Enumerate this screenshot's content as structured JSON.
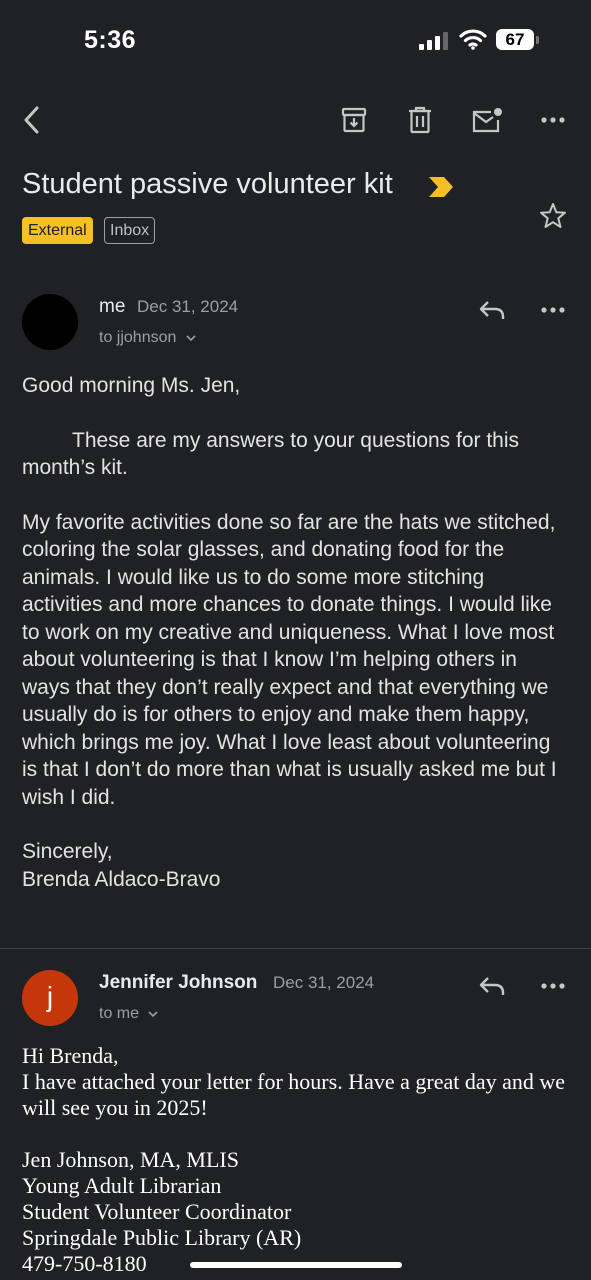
{
  "status_bar": {
    "time": "5:36",
    "battery": "67"
  },
  "toolbar": {
    "back_icon": "arrow-back-icon",
    "archive_icon": "archive-icon",
    "delete_icon": "trash-icon",
    "mark_unread_icon": "mail-unread-icon",
    "more_icon": "more-horizontal-icon"
  },
  "subject": "Student passive volunteer kit",
  "labels": {
    "external": "External",
    "inbox": "Inbox"
  },
  "colors": {
    "background": "#202124",
    "external_badge": "#f6bf26",
    "importance_marker": "#f6bf26",
    "avatar_jennifer": "#c5360b"
  },
  "messages": [
    {
      "sender": "me",
      "date": "Dec 31, 2024",
      "recipient": "to jjohnson",
      "body": {
        "greeting": "Good morning Ms. Jen,",
        "p1": "These are my answers to your questions for this month’s kit.",
        "p2": "My favorite activities done so far are the hats we stitched, coloring the solar glasses, and donating food for the animals. I would like us to do some more stitching activities and more chances to donate things. I would like to work on my creative and uniqueness. What I love most about volunteering is that I know I’m helping others in ways that they don’t really expect and that everything we usually do is for others to enjoy and make them happy, which brings me joy. What I love least about volunteering is that I don’t do more than what is usually asked me but I wish I did.",
        "closing": "Sincerely,",
        "signature": "Brenda Aldaco-Bravo"
      }
    },
    {
      "sender": "Jennifer Johnson",
      "avatar_letter": "j",
      "date": "Dec 31, 2024",
      "recipient": "to me",
      "body": {
        "greeting": "Hi Brenda,",
        "p1": "I have attached your letter for hours. Have a great day and we will see you in 2025!",
        "sig_name": "Jen Johnson, MA, MLIS",
        "sig_title1": "Young Adult Librarian",
        "sig_title2": "Student Volunteer Coordinator",
        "sig_org": "Springdale Public Library (AR)",
        "sig_phone": "479-750-8180"
      }
    }
  ]
}
